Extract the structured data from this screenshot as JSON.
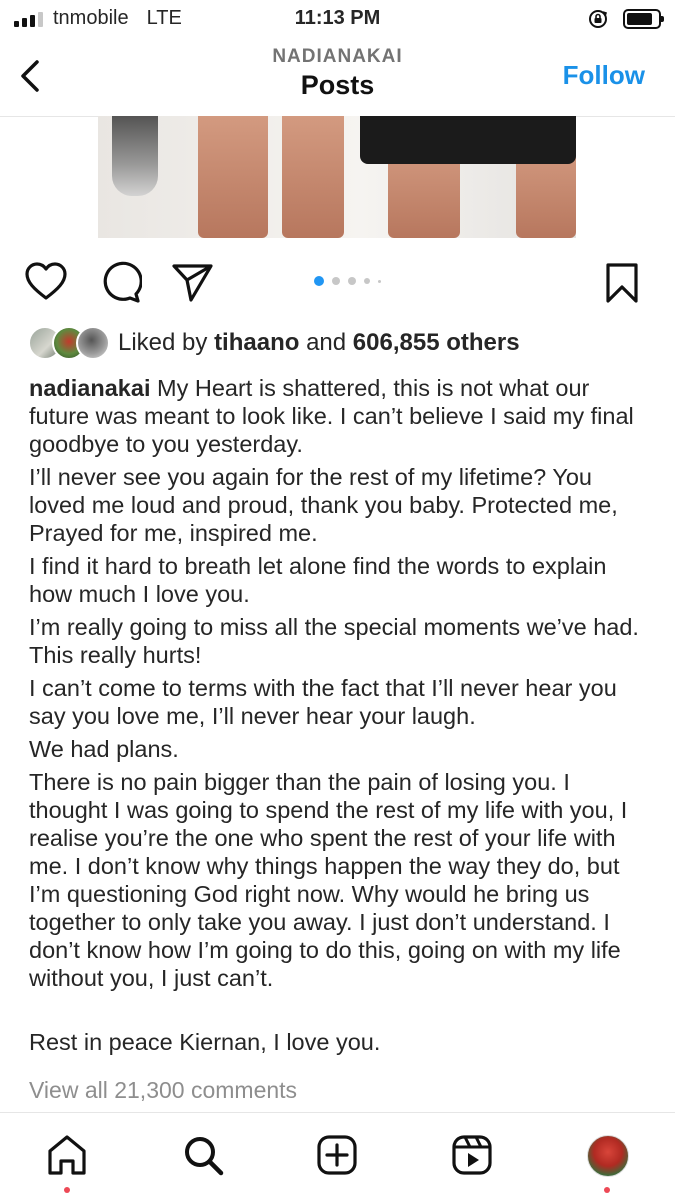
{
  "status_bar": {
    "carrier": "tnmobile",
    "network": "LTE",
    "time": "11:13 PM"
  },
  "header": {
    "username": "NADIANAKAI",
    "title": "Posts",
    "follow_label": "Follow"
  },
  "carousel": {
    "total_dots": 5,
    "active_index": 0
  },
  "likes": {
    "prefix": "Liked by",
    "user": "tihaano",
    "connector": "and",
    "count": "606,855 others"
  },
  "caption": {
    "username": "nadianakai",
    "first_line": "My Heart is shattered, this is not what our future was meant to look like. I can’t believe I said my final goodbye to you yesterday.",
    "paragraphs": [
      "I’ll never see you again for the rest of my lifetime? You loved me loud and proud, thank you baby. Protected me, Prayed for me, inspired me.",
      "I find it hard to breath let alone find the words to explain how much I love you.",
      "I’m really going to miss all the special moments we’ve had. This really hurts!",
      "I can’t come to terms with the fact that I’ll never hear you say you love me, I’ll never hear your laugh.",
      "We had plans.",
      "There is no pain bigger than the pain of losing you. I thought I was going to spend the rest of my life with you, I realise you’re the one who spent the rest of your life with me. I don’t know why things happen the way they do, but I’m questioning God right now. Why would he bring us together to only take you away. I just don’t understand. I don’t know how I’m going to do this, going on with my life without you, I just can’t."
    ],
    "closing": "Rest in peace Kiernan, I love you."
  },
  "comments_link": "View all 21,300 comments",
  "icons": {
    "back": "chevron-left-icon",
    "like": "heart-icon",
    "comment": "comment-icon",
    "share": "paper-plane-icon",
    "save": "bookmark-icon",
    "home": "home-icon",
    "search": "search-icon",
    "create": "plus-square-icon",
    "reels": "reels-icon"
  },
  "colors": {
    "accent": "#1a91e8",
    "notification": "#ed4956",
    "muted": "#8e8e8e"
  }
}
